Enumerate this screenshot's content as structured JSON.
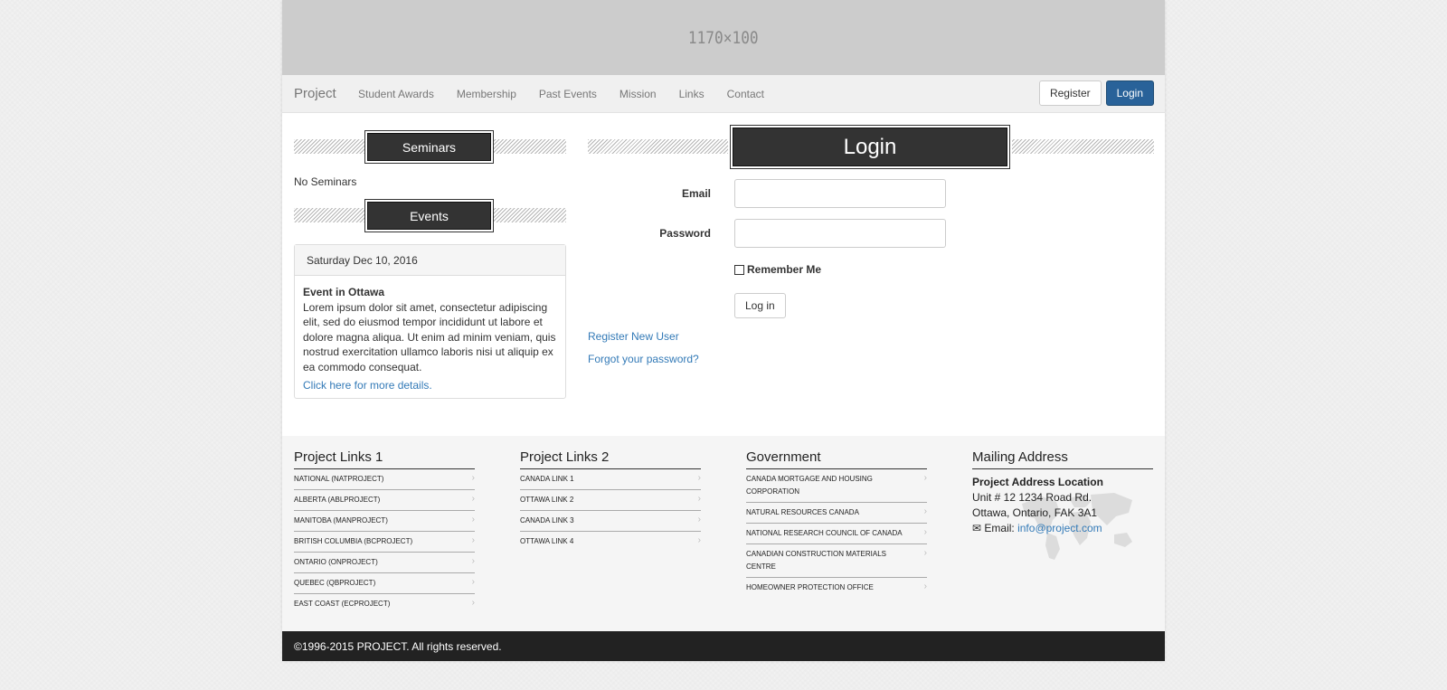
{
  "banner": {
    "text": "1170×100"
  },
  "navbar": {
    "brand": "Project",
    "items": [
      "Student Awards",
      "Membership",
      "Past Events",
      "Mission",
      "Links",
      "Contact"
    ],
    "register_label": "Register",
    "login_label": "Login"
  },
  "sidebar": {
    "seminars_title": "Seminars",
    "no_seminars": "No Seminars",
    "events_title": "Events",
    "event": {
      "date": "Saturday Dec 10, 2016",
      "title": "Event in Ottawa",
      "body": "Lorem ipsum dolor sit amet, consectetur adipiscing elit, sed do eiusmod tempor incididunt ut labore et dolore magna aliqua. Ut enim ad minim veniam, quis nostrud exercitation ullamco laboris nisi ut aliquip ex ea commodo consequat.",
      "link": "Click here for more details."
    }
  },
  "login": {
    "title": "Login",
    "email_label": "Email",
    "password_label": "Password",
    "remember_label": "Remember Me",
    "button_label": "Log in",
    "register_link": "Register New User",
    "forgot_link": "Forgot your password?"
  },
  "footer": {
    "col1": {
      "title": "Project Links 1",
      "items": [
        "National (NATPROJECT)",
        "Alberta (ABLPROJECT)",
        "Manitoba (MANPROJECT)",
        "British Columbia (BCPROJECT)",
        "Ontario (ONPROJECT)",
        "Quebec (QBPROJECT)",
        "East Coast (ECPROJECT)"
      ]
    },
    "col2": {
      "title": "Project Links 2",
      "items": [
        "Canada Link 1",
        "Ottawa Link 2",
        "Canada Link 3",
        "Ottawa Link 4"
      ]
    },
    "col3": {
      "title": "Government",
      "items": [
        "Canada Mortgage and Housing Corporation",
        "Natural Resources Canada",
        "National Research Council of Canada",
        "Canadian Construction Materials Centre",
        "Homeowner Protection Office"
      ]
    },
    "col4": {
      "title": "Mailing Address",
      "address_title": "Project Address Location",
      "line1": "Unit # 12 1234 Road Rd.",
      "line2": "Ottawa, Ontario, FAK 3A1",
      "email_label": "Email:",
      "email": "info@project.com"
    },
    "copyright": "©1996-2015 PROJECT. All rights reserved."
  },
  "colors": {
    "brand_blue": "#296299",
    "link_blue": "#337ab7",
    "dark": "#333333",
    "footer_bar": "#222222"
  }
}
